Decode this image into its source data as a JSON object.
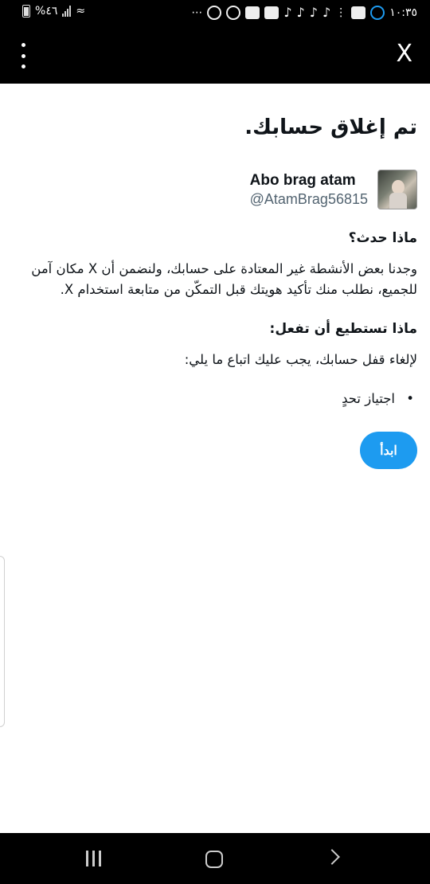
{
  "status_bar": {
    "time": "١٠:٣٥",
    "battery": "%٤٦"
  },
  "app_bar": {
    "close_label": "X"
  },
  "page": {
    "title": "تم إغلاق حسابك.",
    "account": {
      "name": "Abo brag atam",
      "handle": "@AtamBrag56815"
    },
    "what_happened": {
      "heading": "ماذا حدث؟",
      "body": "وجدنا بعض الأنشطة غير المعتادة على حسابك، ولنضمن أن X مكان آمن للجميع، نطلب منك تأكيد هويتك قبل التمكّن من متابعة استخدام X."
    },
    "what_to_do": {
      "heading": "ماذا تستطيع أن تفعل:",
      "body": "لإلغاء قفل حسابك، يجب عليك اتباع ما يلي:",
      "steps": [
        "اجتياز تحدٍ"
      ]
    },
    "start_button": "ابدأ"
  },
  "colors": {
    "accent": "#1d9bf0",
    "bars": "#000000",
    "handle_text": "#536471"
  }
}
